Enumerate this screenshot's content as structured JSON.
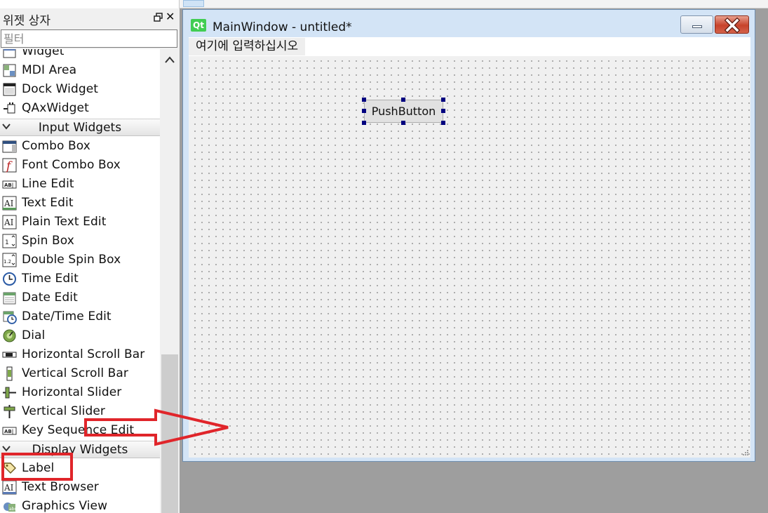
{
  "widget_box": {
    "title": "위젯 상자",
    "filter_placeholder": "필터",
    "items": [
      {
        "type": "item",
        "label": "Widget",
        "icon": "widget-icon"
      },
      {
        "type": "item",
        "label": "MDI Area",
        "icon": "mdi-area-icon"
      },
      {
        "type": "item",
        "label": "Dock Widget",
        "icon": "dock-widget-icon"
      },
      {
        "type": "item",
        "label": "QAxWidget",
        "icon": "qaxwidget-icon"
      },
      {
        "type": "category",
        "label": "Input Widgets"
      },
      {
        "type": "item",
        "label": "Combo Box",
        "icon": "combo-box-icon"
      },
      {
        "type": "item",
        "label": "Font Combo Box",
        "icon": "font-combo-box-icon"
      },
      {
        "type": "item",
        "label": "Line Edit",
        "icon": "line-edit-icon"
      },
      {
        "type": "item",
        "label": "Text Edit",
        "icon": "text-edit-icon"
      },
      {
        "type": "item",
        "label": "Plain Text Edit",
        "icon": "plain-text-edit-icon"
      },
      {
        "type": "item",
        "label": "Spin Box",
        "icon": "spin-box-icon"
      },
      {
        "type": "item",
        "label": "Double Spin Box",
        "icon": "double-spin-box-icon"
      },
      {
        "type": "item",
        "label": "Time Edit",
        "icon": "time-edit-icon"
      },
      {
        "type": "item",
        "label": "Date Edit",
        "icon": "date-edit-icon"
      },
      {
        "type": "item",
        "label": "Date/Time Edit",
        "icon": "date-time-edit-icon"
      },
      {
        "type": "item",
        "label": "Dial",
        "icon": "dial-icon"
      },
      {
        "type": "item",
        "label": "Horizontal Scroll Bar",
        "icon": "horizontal-scroll-bar-icon"
      },
      {
        "type": "item",
        "label": "Vertical Scroll Bar",
        "icon": "vertical-scroll-bar-icon"
      },
      {
        "type": "item",
        "label": "Horizontal Slider",
        "icon": "horizontal-slider-icon"
      },
      {
        "type": "item",
        "label": "Vertical Slider",
        "icon": "vertical-slider-icon"
      },
      {
        "type": "item",
        "label": "Key Sequence Edit",
        "icon": "key-sequence-edit-icon"
      },
      {
        "type": "category",
        "label": "Display Widgets"
      },
      {
        "type": "item",
        "label": "Label",
        "icon": "label-icon"
      },
      {
        "type": "item",
        "label": "Text Browser",
        "icon": "text-browser-icon"
      },
      {
        "type": "item",
        "label": "Graphics View",
        "icon": "graphics-view-icon"
      }
    ]
  },
  "form_window": {
    "title": "MainWindow - untitled*",
    "app_icon_text": "Qt",
    "menu_placeholder": "여기에 입력하십시오",
    "push_button_label": "PushButton"
  },
  "colors": {
    "annotation_red": "#e0252a",
    "qt_green": "#41cd52",
    "selection_handle": "#00007f"
  }
}
